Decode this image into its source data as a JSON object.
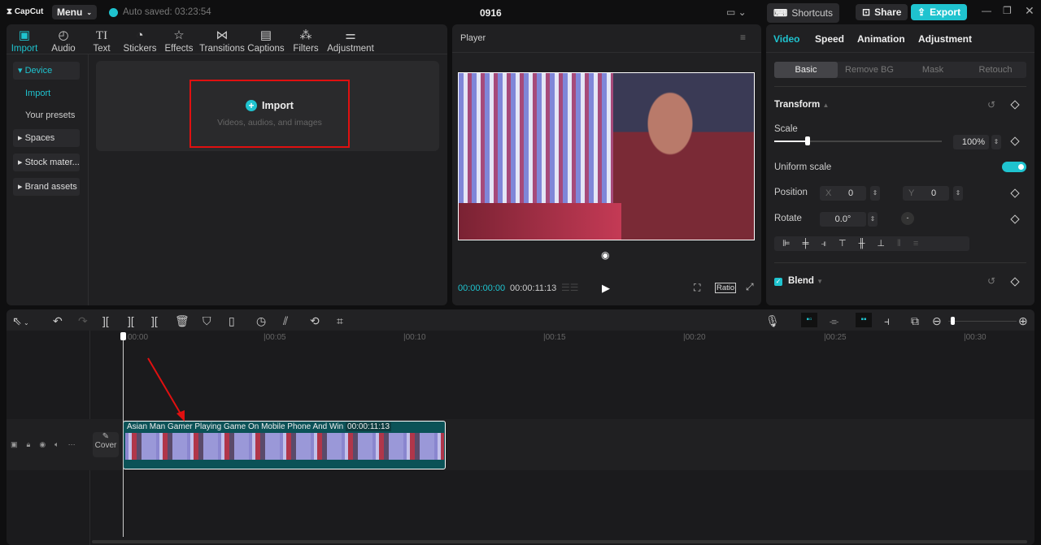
{
  "app": {
    "logo": "CapCut",
    "menu": "Menu",
    "autosave": "Auto saved: 03:23:54",
    "title": "0916",
    "shortcuts": "Shortcuts",
    "share": "Share",
    "export": "Export"
  },
  "toolbar": [
    {
      "icon": "import-icon",
      "label": "Import",
      "active": true
    },
    {
      "icon": "audio-icon",
      "label": "Audio"
    },
    {
      "icon": "text-icon",
      "label": "Text"
    },
    {
      "icon": "stickers-icon",
      "label": "Stickers"
    },
    {
      "icon": "effects-icon",
      "label": "Effects"
    },
    {
      "icon": "transitions-icon",
      "label": "Transitions"
    },
    {
      "icon": "captions-icon",
      "label": "Captions"
    },
    {
      "icon": "filters-icon",
      "label": "Filters"
    },
    {
      "icon": "adjustment-icon",
      "label": "Adjustment"
    }
  ],
  "sidebar": {
    "device": "Device",
    "import": "Import",
    "presets": "Your presets",
    "spaces": "Spaces",
    "stock": "Stock mater...",
    "brand": "Brand assets"
  },
  "import_box": {
    "title": "Import",
    "subtitle": "Videos, audios, and images"
  },
  "player": {
    "title": "Player",
    "current": "00:00:00:00",
    "total": "00:00:11:13",
    "ratio": "Ratio"
  },
  "inspector": {
    "tabs": [
      "Video",
      "Speed",
      "Animation",
      "Adjustment"
    ],
    "subtabs": [
      "Basic",
      "Remove BG",
      "Mask",
      "Retouch"
    ],
    "transform": "Transform",
    "scale_label": "Scale",
    "scale_value": "100%",
    "scale_fraction": 0.2,
    "uniform": "Uniform scale",
    "uniform_on": true,
    "position": "Position",
    "x_label": "X",
    "x": "0",
    "y_label": "Y",
    "y": "0",
    "rotate": "Rotate",
    "rotate_value": "0.0°",
    "blend": "Blend"
  },
  "timeline": {
    "ticks": [
      "00:00",
      "|00:05",
      "|00:10",
      "|00:15",
      "|00:20",
      "|00:25",
      "|00:30"
    ],
    "cover": "Cover",
    "clip_title": "Asian Man Gamer Playing Game On Mobile Phone And Win",
    "clip_duration": "00:00:11:13"
  },
  "colors": {
    "accent": "#1fc3cf",
    "clip": "#0b5257",
    "highlight": "#e01010"
  }
}
